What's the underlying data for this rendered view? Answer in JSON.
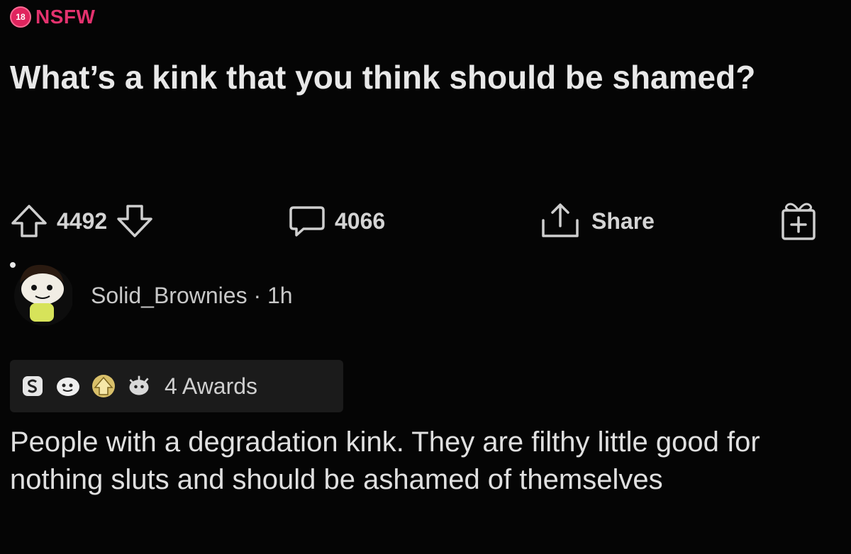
{
  "post": {
    "nsfw_badge": "18",
    "nsfw_label": "NSFW",
    "title": "What’s a kink that you think should be shamed?",
    "upvotes": "4492",
    "comments": "4066",
    "share_label": "Share"
  },
  "comment": {
    "author": "Solid_Brownies",
    "time": "1h",
    "awards_label": "4 Awards",
    "body": "People with a degradation kink. They are filthy little good for nothing sluts and should be ashamed of themselves"
  },
  "icons": {
    "upvote": "arrow-up-icon",
    "downvote": "arrow-down-icon",
    "comment": "comment-bubble-icon",
    "share": "share-icon",
    "award": "gift-icon"
  },
  "colors": {
    "background": "#050505",
    "nsfw": "#e4326e",
    "text": "#e0e0e0"
  }
}
